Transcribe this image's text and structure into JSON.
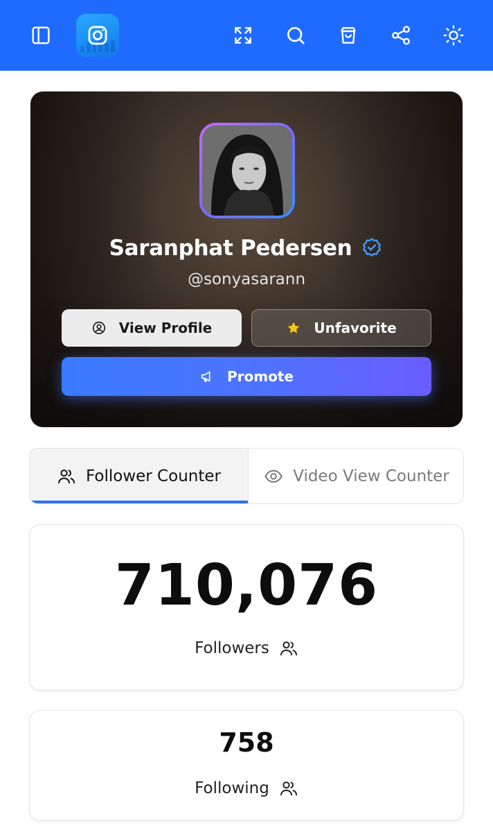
{
  "topbar": {
    "icons": [
      "sidebar-toggle-icon",
      "instagram-logo-icon",
      "fullscreen-icon",
      "search-icon",
      "shopping-bag-icon",
      "share-icon",
      "theme-sun-icon"
    ],
    "color": "#1f6bff"
  },
  "profile": {
    "name": "Saranphat Pedersen",
    "handle": "@sonyasarann",
    "verified": true,
    "view_profile_label": "View Profile",
    "unfavorite_label": "Unfavorite",
    "promote_label": "Promote"
  },
  "tabs": [
    {
      "label": "Follower Counter",
      "icon": "users-icon",
      "active": true
    },
    {
      "label": "Video View Counter",
      "icon": "eye-icon",
      "active": false
    }
  ],
  "stats": {
    "followers": {
      "value": "710,076",
      "label": "Followers"
    },
    "following": {
      "value": "758",
      "label": "Following"
    }
  },
  "colors": {
    "accent": "#2f6ef7",
    "promote_gradient_start": "#3a7bff",
    "promote_gradient_end": "#6a5cff",
    "star": "#f5c518"
  }
}
